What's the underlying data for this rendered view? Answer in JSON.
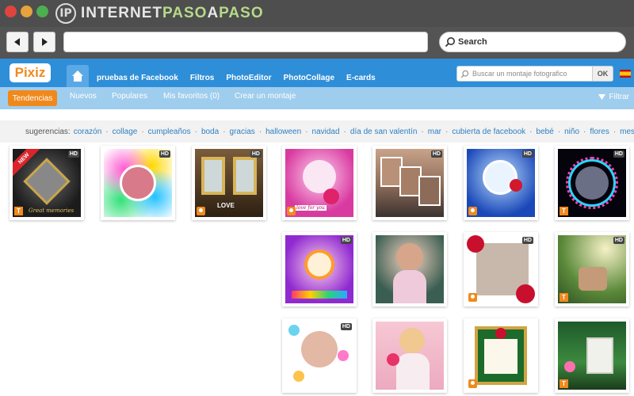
{
  "window": {
    "brand_text_1": "INTERNET",
    "brand_text_2": "PASO",
    "brand_text_3": "A",
    "brand_text_4": "PASO",
    "brand_logo_letter": "IP"
  },
  "browser": {
    "search_label": "Search"
  },
  "site": {
    "logo": "Pixiz",
    "nav": [
      "pruebas de Facebook",
      "Filtros",
      "PhotoEditor",
      "PhotoCollage",
      "E-cards"
    ],
    "search_placeholder": "Buscar un montaje fotografico",
    "search_button": "OK"
  },
  "subnav": {
    "active": "Tendencias",
    "items": [
      "Nuevos",
      "Populares",
      "Mis favoritos (0)",
      "Crear un montaje"
    ],
    "filter": "Filtrar"
  },
  "suggestions": {
    "label": "sugerencias:",
    "tags": [
      "corazón",
      "collage",
      "cumpleaños",
      "boda",
      "gracias",
      "halloween",
      "navidad",
      "día de san valentín",
      "mar",
      "cubierta de facebook",
      "bebé",
      "niño",
      "flores",
      "mesa"
    ]
  },
  "tiles": {
    "hd_label": "HD",
    "new_label": "NEW",
    "t_label": "T",
    "love_label": "LOVE",
    "grad_caption": "Great memories",
    "hearts_caption": "love for you"
  },
  "colors": {
    "header": "#2f8ed8",
    "subnav": "#9fcdee",
    "accent": "#f0891c",
    "link": "#2f7fc1"
  }
}
